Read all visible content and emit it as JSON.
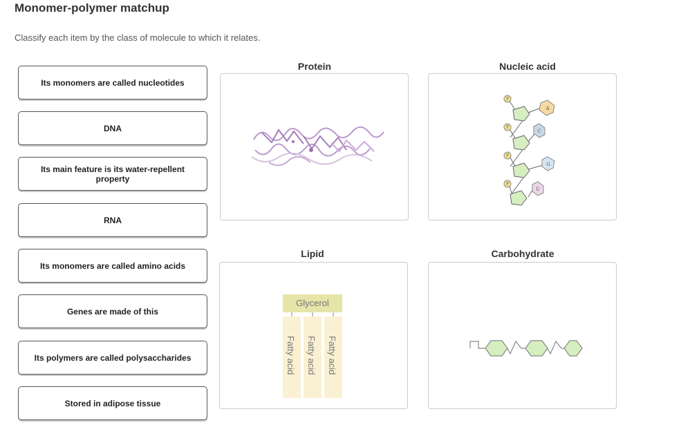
{
  "header": {
    "title": "Monomer-polymer matchup",
    "instructions": "Classify each item by the class of molecule to which it relates."
  },
  "cards": [
    {
      "label": "Its monomers are called nucleotides"
    },
    {
      "label": "DNA"
    },
    {
      "label": "Its main feature is its water-repellent property"
    },
    {
      "label": "RNA"
    },
    {
      "label": "Its monomers are called amino acids"
    },
    {
      "label": "Genes are made of this"
    },
    {
      "label": "Its polymers are called polysaccharides"
    },
    {
      "label": "Stored in adipose tissue"
    }
  ],
  "zones": {
    "protein": {
      "label": "Protein"
    },
    "nucleic": {
      "label": "Nucleic acid",
      "bases": [
        "A",
        "C",
        "G",
        "U"
      ],
      "phosphate": "P"
    },
    "lipid": {
      "label": "Lipid",
      "glycerol": "Glycerol",
      "fatty_acid": "Fatty acid"
    },
    "carbohydrate": {
      "label": "Carbohydrate"
    }
  },
  "colors": {
    "protein_ribbon": "#b48fc8",
    "sugar_green": "#d6eec0",
    "base_A": "#f7d9a3",
    "base_C": "#c9d9ea",
    "base_G": "#d6e6f5",
    "base_U": "#ecd7ea",
    "phosphate": "#f2e58c",
    "glycerol": "#e6e4a9",
    "fatty_acid": "#faf1d2"
  }
}
